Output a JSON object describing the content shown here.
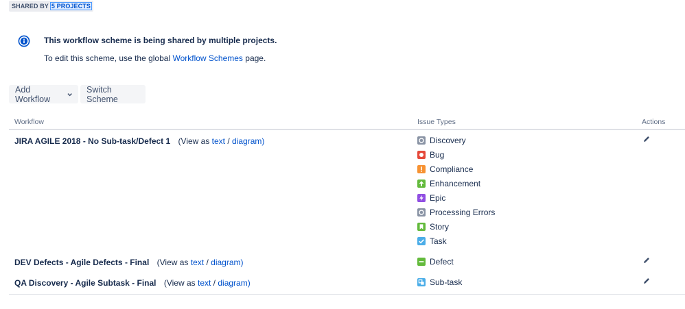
{
  "header": {
    "shared_by_label": "SHARED BY",
    "shared_by_link": "5 PROJECTS"
  },
  "info": {
    "title": "This workflow scheme is being shared by multiple projects.",
    "text_before": "To edit this scheme, use the global",
    "link": "Workflow Schemes",
    "text_after": "page."
  },
  "toolbar": {
    "add_workflow": "Add Workflow",
    "switch_scheme": "Switch Scheme"
  },
  "table": {
    "headers": {
      "workflow": "Workflow",
      "issue_types": "Issue Types",
      "actions": "Actions"
    },
    "view_prefix": "(View as",
    "view_text": "text",
    "view_sep": "/",
    "view_diagram": "diagram)",
    "rows": [
      {
        "name": "JIRA AGILE 2018 - No Sub-task/Defect 1",
        "issue_types": [
          {
            "label": "Discovery",
            "icon": "discovery-icon",
            "color": "#8993a4"
          },
          {
            "label": "Bug",
            "icon": "bug-icon",
            "color": "#e5493a"
          },
          {
            "label": "Compliance",
            "icon": "compliance-icon",
            "color": "#f79232"
          },
          {
            "label": "Enhancement",
            "icon": "enhancement-icon",
            "color": "#63ba3c"
          },
          {
            "label": "Epic",
            "icon": "epic-icon",
            "color": "#904ee2"
          },
          {
            "label": "Processing Errors",
            "icon": "processing-errors-icon",
            "color": "#8993a4"
          },
          {
            "label": "Story",
            "icon": "story-icon",
            "color": "#63ba3c"
          },
          {
            "label": "Task",
            "icon": "task-icon",
            "color": "#4bade8"
          }
        ]
      },
      {
        "name": "DEV Defects - Agile Defects - Final",
        "issue_types": [
          {
            "label": "Defect",
            "icon": "defect-icon",
            "color": "#63ba3c"
          }
        ]
      },
      {
        "name": "QA Discovery - Agile Subtask - Final",
        "issue_types": [
          {
            "label": "Sub-task",
            "icon": "sub-task-icon",
            "color": "#4bade8"
          }
        ]
      }
    ]
  }
}
